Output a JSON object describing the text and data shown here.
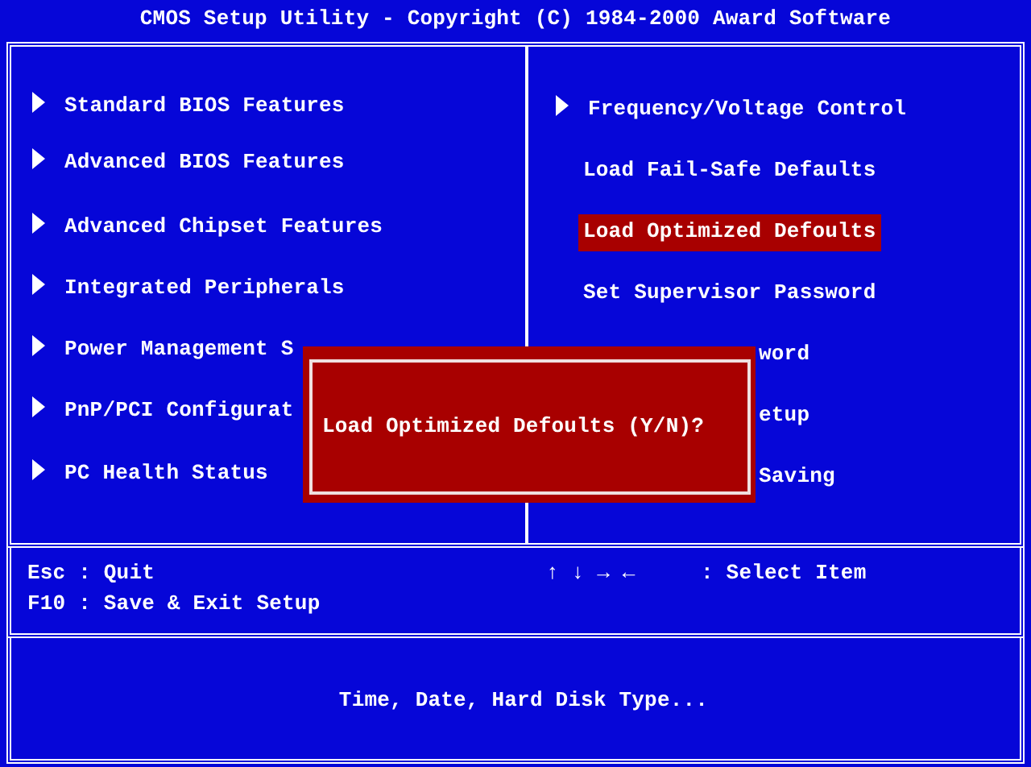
{
  "window": {
    "title": "CMOS Setup Utility - Copyright (C) 1984-2000 Award Software"
  },
  "left_menu": [
    {
      "label": "Standard BIOS Features",
      "kind": "arrow",
      "selected": false
    },
    {
      "label": "Advanced BIOS Features",
      "kind": "arrow",
      "selected": false
    },
    {
      "label": "Advanced Chipset Features",
      "kind": "arrow",
      "selected": false
    },
    {
      "label": "Integrated Peripherals",
      "kind": "arrow",
      "selected": false
    },
    {
      "label": "Power Management S",
      "kind": "arrow",
      "selected": false
    },
    {
      "label": "PnP/PCI Configurat",
      "kind": "arrow",
      "selected": false
    },
    {
      "label": "PC Health Status",
      "kind": "arrow",
      "selected": false
    }
  ],
  "right_menu": [
    {
      "label": "Frequency/Voltage Control",
      "kind": "arrow",
      "selected": false
    },
    {
      "label": "Load Fail-Safe Defaults",
      "kind": "plain",
      "selected": false
    },
    {
      "label": "Load Optimized Defoults",
      "kind": "plain",
      "selected": true
    },
    {
      "label": "Set Supervisor Password",
      "kind": "plain",
      "selected": false
    },
    {
      "label": "word",
      "kind": "partial",
      "selected": false
    },
    {
      "label": "etup",
      "kind": "partial",
      "selected": false
    },
    {
      "label": "Saving",
      "kind": "partial",
      "selected": false
    }
  ],
  "dialog": {
    "message": "Load Optimized Defoults (Y/N)?"
  },
  "help": {
    "left": [
      "Esc : Quit",
      "F10 : Save & Exit Setup"
    ],
    "keys": "↑ ↓ → ←",
    "action": ": Select Item"
  },
  "description": "Time, Date, Hard Disk Type..."
}
